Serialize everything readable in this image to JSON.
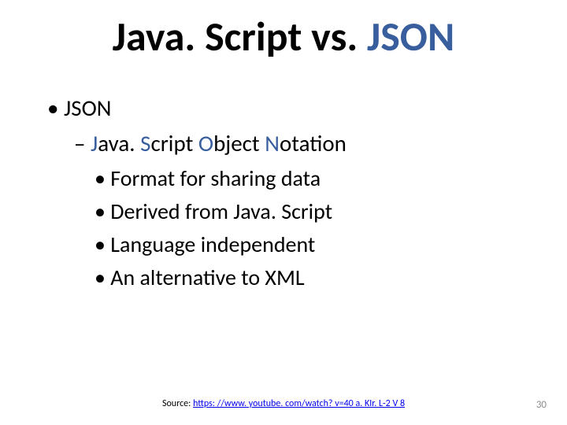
{
  "title": {
    "full": "Java. Script vs. JSON",
    "pre": "Java. Script vs. ",
    "hl": "JSON"
  },
  "bullet1": "JSON",
  "acronym": {
    "j": "J",
    "one": "ava. ",
    "s": "S",
    "two": "cript ",
    "o": "O",
    "three": "bject ",
    "n": "N",
    "four": "otation"
  },
  "points": {
    "a": "Format for sharing data",
    "b": "Derived from Java. Script",
    "c": "Language independent",
    "d": "An alternative to XML"
  },
  "source": {
    "label": "Source: ",
    "url": "https: //www. youtube. com/watch? v=40 a. KIr. L-2 V 8"
  },
  "page": "30"
}
